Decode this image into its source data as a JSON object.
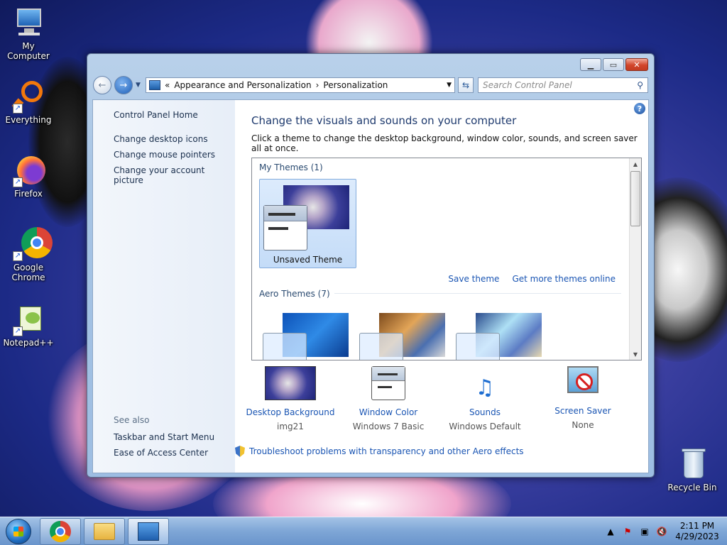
{
  "desktop": {
    "icons": [
      {
        "label": "My Computer"
      },
      {
        "label": "Everything"
      },
      {
        "label": "Firefox"
      },
      {
        "label": "Google Chrome"
      },
      {
        "label": "Notepad++"
      },
      {
        "label": "Recycle Bin"
      }
    ]
  },
  "window": {
    "address": {
      "chevron": "«",
      "crumbs": [
        "Appearance and Personalization",
        "Personalization"
      ],
      "separator": "›"
    },
    "search": {
      "placeholder": "Search Control Panel"
    },
    "left": {
      "home": "Control Panel Home",
      "links": [
        "Change desktop icons",
        "Change mouse pointers",
        "Change your account picture"
      ],
      "see_also": "See also",
      "see_links": [
        "Taskbar and Start Menu",
        "Ease of Access Center"
      ]
    },
    "main": {
      "title": "Change the visuals and sounds on your computer",
      "description": "Click a theme to change the desktop background, window color, sounds, and screen saver all at once.",
      "my_themes": "My Themes (1)",
      "unsaved_theme": "Unsaved Theme",
      "save_theme": "Save theme",
      "get_more": "Get more themes online",
      "aero_themes": "Aero Themes (7)",
      "settings": [
        {
          "name": "Desktop Background",
          "value": "img21"
        },
        {
          "name": "Window Color",
          "value": "Windows 7 Basic"
        },
        {
          "name": "Sounds",
          "value": "Windows Default"
        },
        {
          "name": "Screen Saver",
          "value": "None"
        }
      ],
      "troubleshoot": "Troubleshoot problems with transparency and other Aero effects"
    }
  },
  "taskbar": {
    "time": "2:11 PM",
    "date": "4/29/2023"
  },
  "colors": {
    "link": "#1a55b3",
    "title": "#1e3a6e",
    "close_button": "#d2462b"
  }
}
